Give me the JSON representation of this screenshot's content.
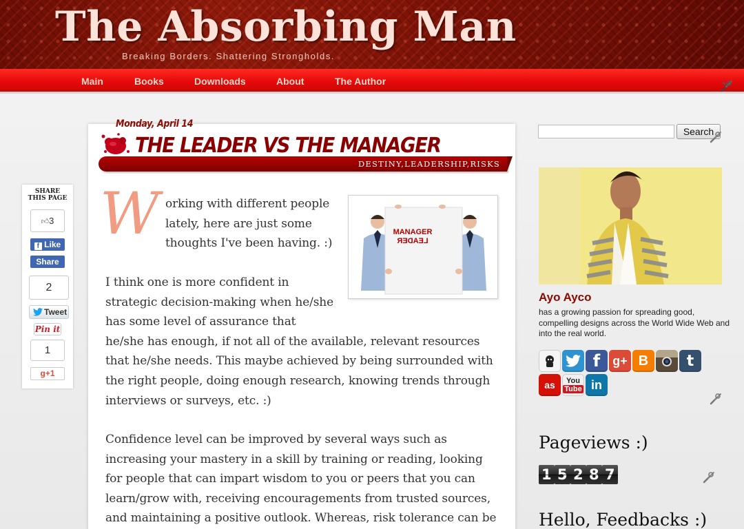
{
  "site": {
    "title": "The Absorbing Man",
    "tagline": "Breaking Borders. Shattering Strongholds."
  },
  "nav": {
    "items": [
      {
        "label": "Main"
      },
      {
        "label": "Books"
      },
      {
        "label": "Downloads"
      },
      {
        "label": "About"
      },
      {
        "label": "The Author"
      }
    ]
  },
  "post": {
    "date": "Monday, April 14",
    "title": "THE LEADER VS THE MANAGER",
    "labels": "DESTINY,LEADERSHIP,RISKS",
    "drop_cap": "W",
    "image": {
      "top_text": "MANAGER",
      "bottom_text": "LEADER"
    },
    "lines": [
      "orking with different people",
      "lately, here are just some",
      "thoughts I've been having. :)",
      "I think one is more confident in",
      "strategic decision-making when he/she",
      "has some level of assurance that",
      "he/she has enough, if not all of the available, relevant resources",
      "that he/she needs. This maybe achieved by being surrounded with",
      "the right people, doing enough research, knowing trends through",
      "interviews or surveys, etc. :)",
      "Confidence level can be improved by several ways such as",
      "increasing your mastery in a skill by training or reading, looking",
      "for people that can impart wisdom to you or peers that you can",
      "learn/grow with, receiving encouragements from trusted sources,",
      "and maintaining a positive outlook. Whereas, risk tolerance can be"
    ]
  },
  "share": {
    "heading_line1": "SHARE",
    "heading_line2": "THIS PAGE",
    "fb_count": "3",
    "fb_like": "Like",
    "fb_share": "Share",
    "tweet_count": "2",
    "tweet_label": "Tweet",
    "pin_label": "Pin it",
    "gplus_count": "1",
    "gplus_label": "g+1"
  },
  "sidebar": {
    "search": {
      "placeholder": "",
      "button": "Search"
    },
    "author": {
      "name": "Ayo Ayco",
      "bio": "has a growing passion for spreading good, compelling designs across the World Wide Web and into the real world."
    },
    "social_icons": [
      "github-icon",
      "twitter-icon",
      "facebook-icon",
      "google-plus-icon",
      "blogger-icon",
      "instagram-icon",
      "tumblr-icon",
      "lastfm-icon",
      "youtube-icon",
      "linkedin-icon"
    ],
    "pageviews": {
      "title": "Pageviews :)",
      "digits": [
        "1",
        "5",
        "2",
        "8",
        "7"
      ]
    },
    "feedback": {
      "title": "Hello, Feedbacks :)"
    }
  },
  "colors": {
    "nav_red": "#e60a0a",
    "title_dark_red": "#8a0000",
    "drop_cap": "#f29b83",
    "fb_blue": "#4267b2",
    "twitter_blue": "#1da1f2"
  }
}
